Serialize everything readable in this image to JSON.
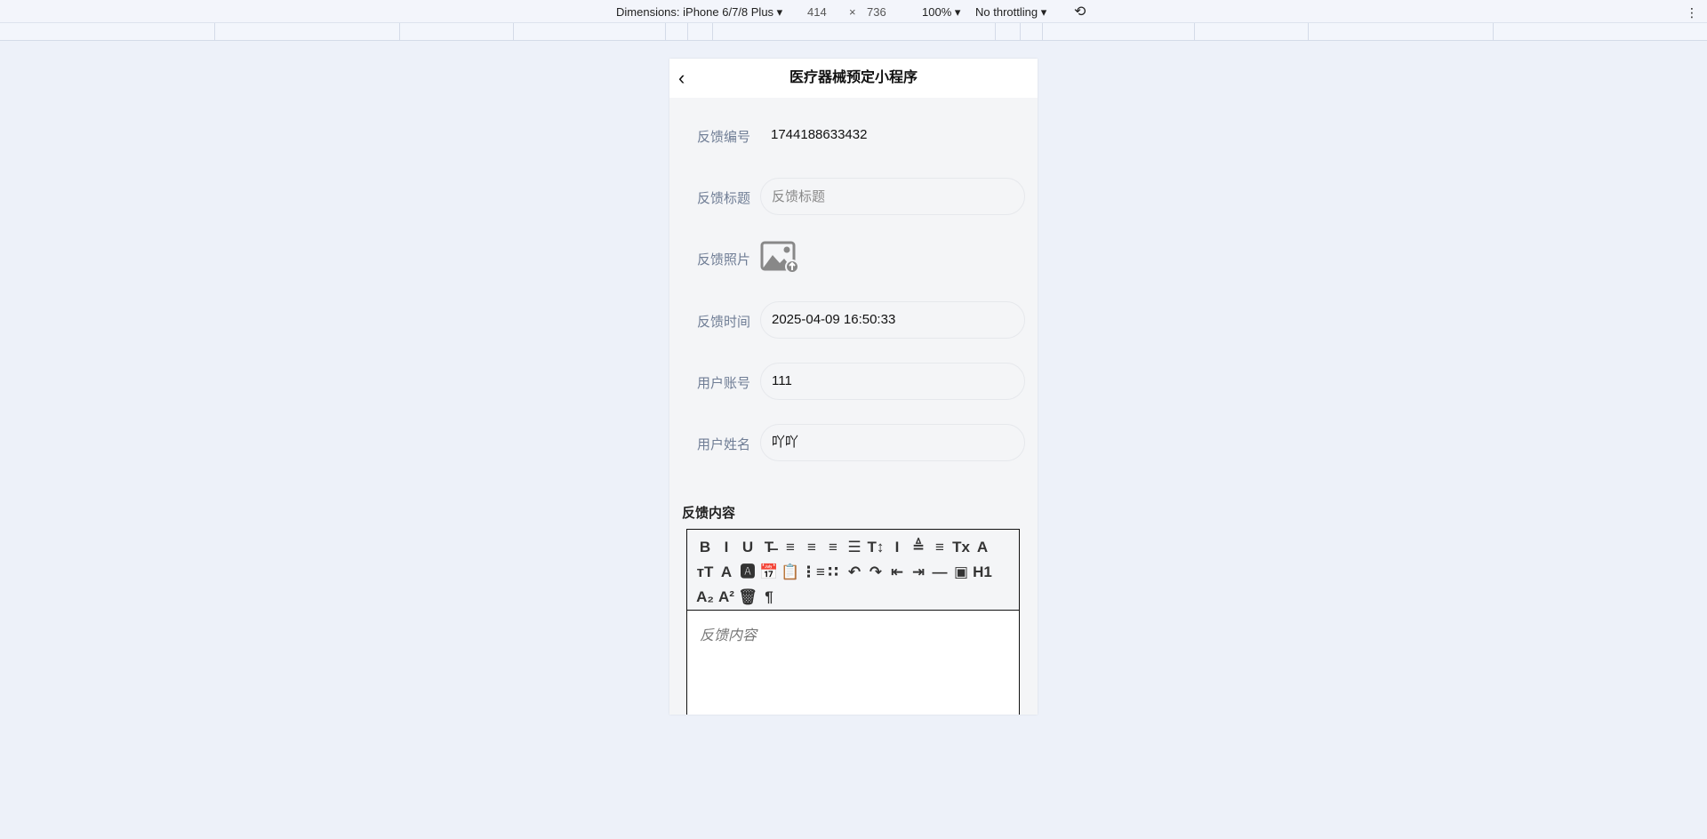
{
  "devtools": {
    "dimensions": "Dimensions: iPhone 6/7/8 Plus ▾",
    "width": "414",
    "times": "×",
    "height": "736",
    "zoom": "100% ▾",
    "throttling": "No throttling ▾",
    "rotate_icon": "⟲",
    "menu_icon": "⋮"
  },
  "header": {
    "title": "医疗器械预定小程序",
    "back_icon": "‹"
  },
  "form": {
    "id": {
      "label": "反馈编号",
      "value": "1744188633432"
    },
    "title": {
      "label": "反馈标题",
      "placeholder": "反馈标题"
    },
    "photo": {
      "label": "反馈照片"
    },
    "time": {
      "label": "反馈时间",
      "value": "2025-04-09 16:50:33"
    },
    "account": {
      "label": "用户账号",
      "value": "111"
    },
    "name": {
      "label": "用户姓名",
      "value": "吖吖"
    }
  },
  "content": {
    "label": "反馈内容",
    "placeholder": "反馈内容"
  },
  "toolbar": [
    {
      "name": "bold-icon",
      "g": "B"
    },
    {
      "name": "italic-icon",
      "g": "I"
    },
    {
      "name": "underline-icon",
      "g": "U"
    },
    {
      "name": "strikethrough-icon",
      "g": "T̶"
    },
    {
      "name": "align-left-icon",
      "g": "≡"
    },
    {
      "name": "align-center-icon",
      "g": "≡"
    },
    {
      "name": "align-right-icon",
      "g": "≡"
    },
    {
      "name": "align-justify-icon",
      "g": "☰"
    },
    {
      "name": "line-height-icon",
      "g": "T↕"
    },
    {
      "name": "letter-spacing-icon",
      "g": "I"
    },
    {
      "name": "margin-top-icon",
      "g": "≜"
    },
    {
      "name": "margin-bottom-icon",
      "g": "≡"
    },
    {
      "name": "remove-format-icon",
      "g": "Tx"
    },
    {
      "name": "font-icon",
      "g": "A"
    },
    {
      "name": "font-size-icon",
      "g": "ᴛT"
    },
    {
      "name": "font-color-icon",
      "g": "A"
    },
    {
      "name": "background-color-icon",
      "g": "🅰"
    },
    {
      "name": "date-icon",
      "g": "📅"
    },
    {
      "name": "checklist-icon",
      "g": "📋"
    },
    {
      "name": "ordered-list-icon",
      "g": "⋮≡"
    },
    {
      "name": "bullet-list-icon",
      "g": "∷"
    },
    {
      "name": "undo-icon",
      "g": "↶"
    },
    {
      "name": "redo-icon",
      "g": "↷"
    },
    {
      "name": "outdent-icon",
      "g": "⇤"
    },
    {
      "name": "indent-icon",
      "g": "⇥"
    },
    {
      "name": "divider-icon",
      "g": "—"
    },
    {
      "name": "image-icon",
      "g": "▣"
    },
    {
      "name": "heading-icon",
      "g": "H1"
    },
    {
      "name": "subscript-icon",
      "g": "A₂"
    },
    {
      "name": "superscript-icon",
      "g": "A²"
    },
    {
      "name": "clear-icon",
      "g": "🗑"
    },
    {
      "name": "paragraph-icon",
      "g": "¶"
    }
  ]
}
